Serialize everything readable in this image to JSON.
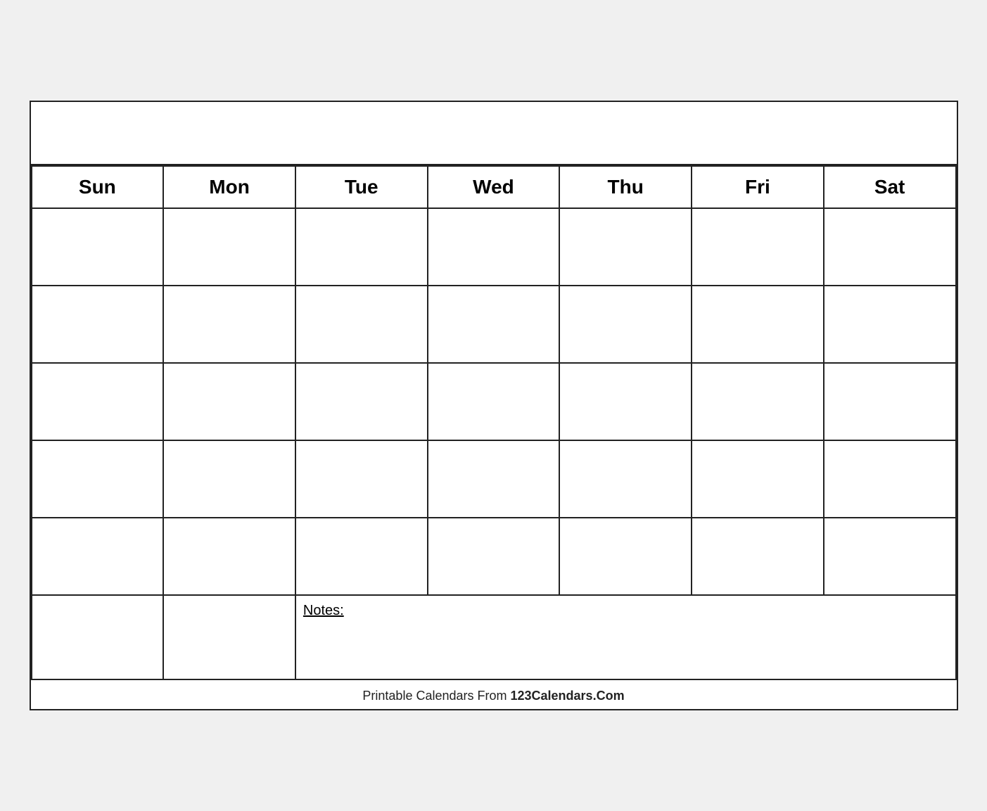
{
  "calendar": {
    "title": "",
    "days": [
      "Sun",
      "Mon",
      "Tue",
      "Wed",
      "Thu",
      "Fri",
      "Sat"
    ],
    "weeks": 5,
    "notes_label": "Notes:",
    "footer_text": "Printable Calendars From ",
    "footer_brand": "123Calendars.Com"
  }
}
